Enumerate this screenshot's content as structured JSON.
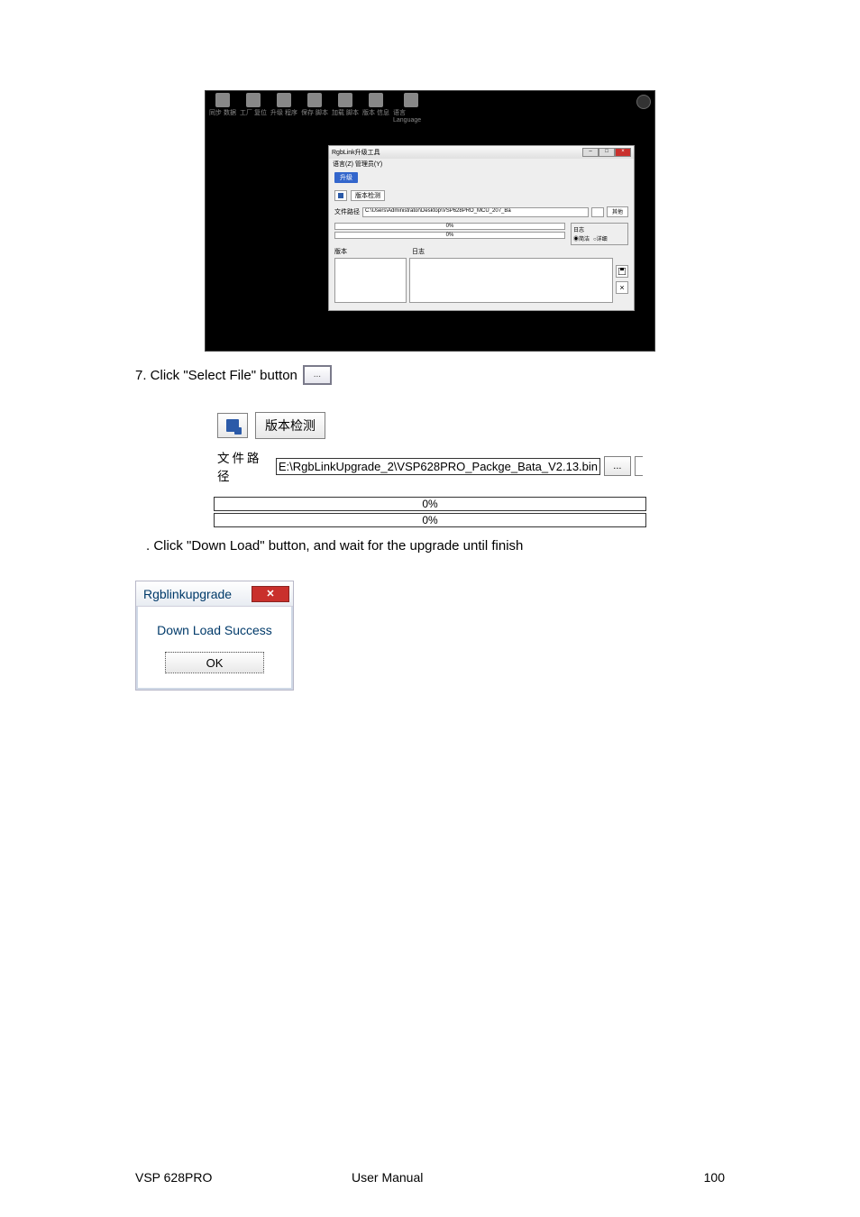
{
  "toolbar": {
    "items": [
      "同步\n数据",
      "工厂\n复位",
      "升级\n程序",
      "保存\n脚本",
      "加载\n脚本",
      "版本\n信息",
      "语言\nLanguage"
    ]
  },
  "innerWindow": {
    "title": "RgbLink升级工具",
    "menu": "语言(Z)  管理员(Y)",
    "upgradeBtn": "升级",
    "detectBtn": "版本检测",
    "pathLabel": "文件路径",
    "pathValue": "C:\\Users\\Administrator\\Desktop\\VSP628PRO_MCU_207_Ba",
    "otherBtn": "其他",
    "progress1": "0%",
    "progress2": "0%",
    "logGroup": "日志",
    "radio1": "简洁",
    "radio2": "详细",
    "panel1": "版本",
    "panel2": "日志"
  },
  "step7": {
    "text": "7. Click \"Select File\" button",
    "btn": "..."
  },
  "screenshot2": {
    "detectBtn": "版本检测",
    "pathLabel": "文件路径",
    "pathValue": "E:\\RgbLinkUpgrade_2\\VSP628PRO_Packge_Bata_V2.13.bin",
    "browse": "...",
    "prog1": "0%",
    "prog2": "0%"
  },
  "step8": {
    "text": ". Click \"Down Load\" button, and wait for the upgrade until finish"
  },
  "dialog": {
    "title": "Rgblinkupgrade",
    "body": "Down Load Success",
    "ok": "OK"
  },
  "footer": {
    "product": "VSP 628PRO",
    "doc": "User Manual",
    "page": "100"
  }
}
